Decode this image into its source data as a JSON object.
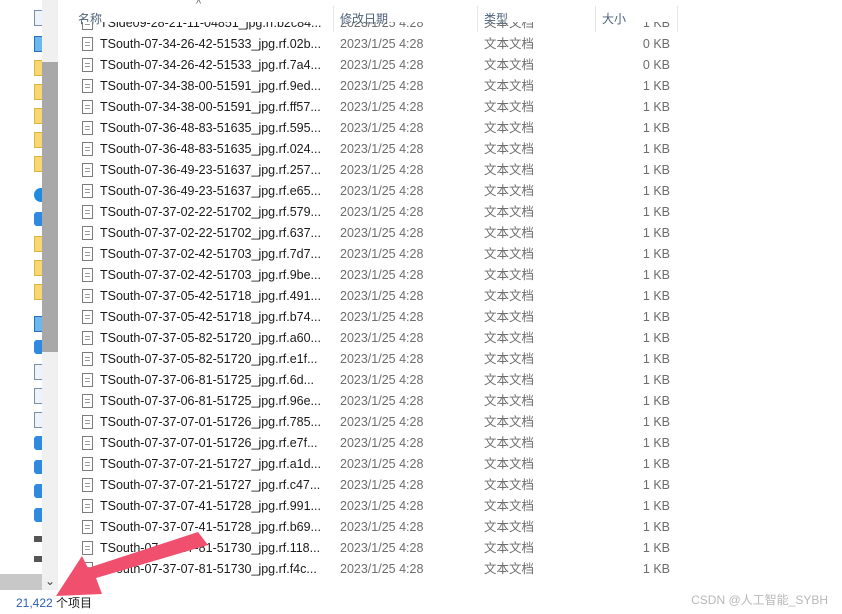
{
  "columns": {
    "name": "名称",
    "date": "修改日期",
    "type": "类型",
    "size": "大小"
  },
  "partial_top_row": {
    "name": "TSide09-28-21-11-04851_jpg.rf.b2c84...",
    "date": "2023/1/25 4:28",
    "type": "文本文档",
    "size": "1 KB"
  },
  "files": [
    {
      "name": "TSouth-07-34-26-42-51533_jpg.rf.02b...",
      "date": "2023/1/25 4:28",
      "type": "文本文档",
      "size": "0 KB"
    },
    {
      "name": "TSouth-07-34-26-42-51533_jpg.rf.7a4...",
      "date": "2023/1/25 4:28",
      "type": "文本文档",
      "size": "0 KB"
    },
    {
      "name": "TSouth-07-34-38-00-51591_jpg.rf.9ed...",
      "date": "2023/1/25 4:28",
      "type": "文本文档",
      "size": "1 KB"
    },
    {
      "name": "TSouth-07-34-38-00-51591_jpg.rf.ff57...",
      "date": "2023/1/25 4:28",
      "type": "文本文档",
      "size": "1 KB"
    },
    {
      "name": "TSouth-07-36-48-83-51635_jpg.rf.595...",
      "date": "2023/1/25 4:28",
      "type": "文本文档",
      "size": "1 KB"
    },
    {
      "name": "TSouth-07-36-48-83-51635_jpg.rf.024...",
      "date": "2023/1/25 4:28",
      "type": "文本文档",
      "size": "1 KB"
    },
    {
      "name": "TSouth-07-36-49-23-51637_jpg.rf.257...",
      "date": "2023/1/25 4:28",
      "type": "文本文档",
      "size": "1 KB"
    },
    {
      "name": "TSouth-07-36-49-23-51637_jpg.rf.e65...",
      "date": "2023/1/25 4:28",
      "type": "文本文档",
      "size": "1 KB"
    },
    {
      "name": "TSouth-07-37-02-22-51702_jpg.rf.579...",
      "date": "2023/1/25 4:28",
      "type": "文本文档",
      "size": "1 KB"
    },
    {
      "name": "TSouth-07-37-02-22-51702_jpg.rf.637...",
      "date": "2023/1/25 4:28",
      "type": "文本文档",
      "size": "1 KB"
    },
    {
      "name": "TSouth-07-37-02-42-51703_jpg.rf.7d7...",
      "date": "2023/1/25 4:28",
      "type": "文本文档",
      "size": "1 KB"
    },
    {
      "name": "TSouth-07-37-02-42-51703_jpg.rf.9be...",
      "date": "2023/1/25 4:28",
      "type": "文本文档",
      "size": "1 KB"
    },
    {
      "name": "TSouth-07-37-05-42-51718_jpg.rf.491...",
      "date": "2023/1/25 4:28",
      "type": "文本文档",
      "size": "1 KB"
    },
    {
      "name": "TSouth-07-37-05-42-51718_jpg.rf.b74...",
      "date": "2023/1/25 4:28",
      "type": "文本文档",
      "size": "1 KB"
    },
    {
      "name": "TSouth-07-37-05-82-51720_jpg.rf.a60...",
      "date": "2023/1/25 4:28",
      "type": "文本文档",
      "size": "1 KB"
    },
    {
      "name": "TSouth-07-37-05-82-51720_jpg.rf.e1f...",
      "date": "2023/1/25 4:28",
      "type": "文本文档",
      "size": "1 KB"
    },
    {
      "name": "TSouth-07-37-06-81-51725_jpg.rf.6d...",
      "date": "2023/1/25 4:28",
      "type": "文本文档",
      "size": "1 KB"
    },
    {
      "name": "TSouth-07-37-06-81-51725_jpg.rf.96e...",
      "date": "2023/1/25 4:28",
      "type": "文本文档",
      "size": "1 KB"
    },
    {
      "name": "TSouth-07-37-07-01-51726_jpg.rf.785...",
      "date": "2023/1/25 4:28",
      "type": "文本文档",
      "size": "1 KB"
    },
    {
      "name": "TSouth-07-37-07-01-51726_jpg.rf.e7f...",
      "date": "2023/1/25 4:28",
      "type": "文本文档",
      "size": "1 KB"
    },
    {
      "name": "TSouth-07-37-07-21-51727_jpg.rf.a1d...",
      "date": "2023/1/25 4:28",
      "type": "文本文档",
      "size": "1 KB"
    },
    {
      "name": "TSouth-07-37-07-21-51727_jpg.rf.c47...",
      "date": "2023/1/25 4:28",
      "type": "文本文档",
      "size": "1 KB"
    },
    {
      "name": "TSouth-07-37-07-41-51728_jpg.rf.991...",
      "date": "2023/1/25 4:28",
      "type": "文本文档",
      "size": "1 KB"
    },
    {
      "name": "TSouth-07-37-07-41-51728_jpg.rf.b69...",
      "date": "2023/1/25 4:28",
      "type": "文本文档",
      "size": "1 KB"
    },
    {
      "name": "TSouth-07-37-07-81-51730_jpg.rf.118...",
      "date": "2023/1/25 4:28",
      "type": "文本文档",
      "size": "1 KB"
    },
    {
      "name": "TSouth-07-37-07-81-51730_jpg.rf.f4c...",
      "date": "2023/1/25 4:28",
      "type": "文本文档",
      "size": "1 KB"
    }
  ],
  "status": {
    "count": "21,422",
    "label": "个项目"
  },
  "watermark": "CSDN @人工智能_SYBH",
  "icons": {
    "sort": "sort-up-icon",
    "file": "text-document-icon",
    "scroll_down": "chevron-down-icon",
    "annotation": "red-arrow-annotation"
  },
  "colors": {
    "header_text": "#4c607a",
    "count_text": "#2b5fb8",
    "annotation_arrow": "#f0506e"
  }
}
